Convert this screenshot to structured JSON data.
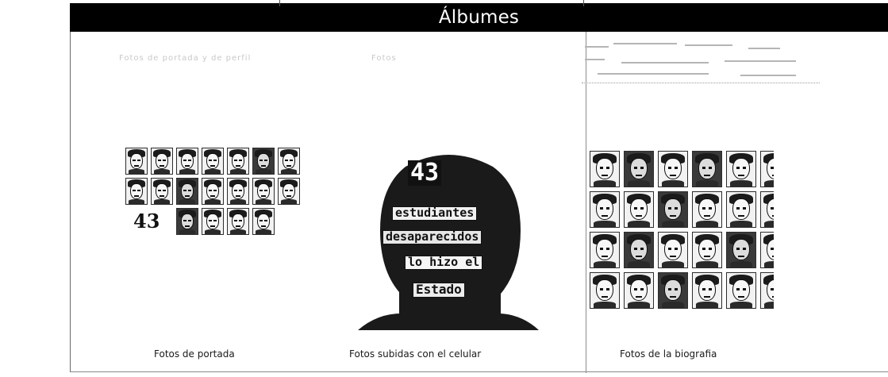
{
  "header": {
    "title": "Álbumes"
  },
  "faint_labels": {
    "label_1": "Fotos de portada y de perfil",
    "label_2": "Fotos"
  },
  "albums": [
    {
      "caption": "Fotos de portada",
      "cover_text": "43"
    },
    {
      "caption": "Fotos subidas con el celular",
      "cover_lines": [
        "43",
        "estudiantes",
        "desaparecidos",
        "lo hizo el",
        "Estado"
      ]
    },
    {
      "caption": "Fotos de la biografia"
    }
  ],
  "colors": {
    "header_bg": "#000000",
    "header_text": "#ffffff"
  }
}
